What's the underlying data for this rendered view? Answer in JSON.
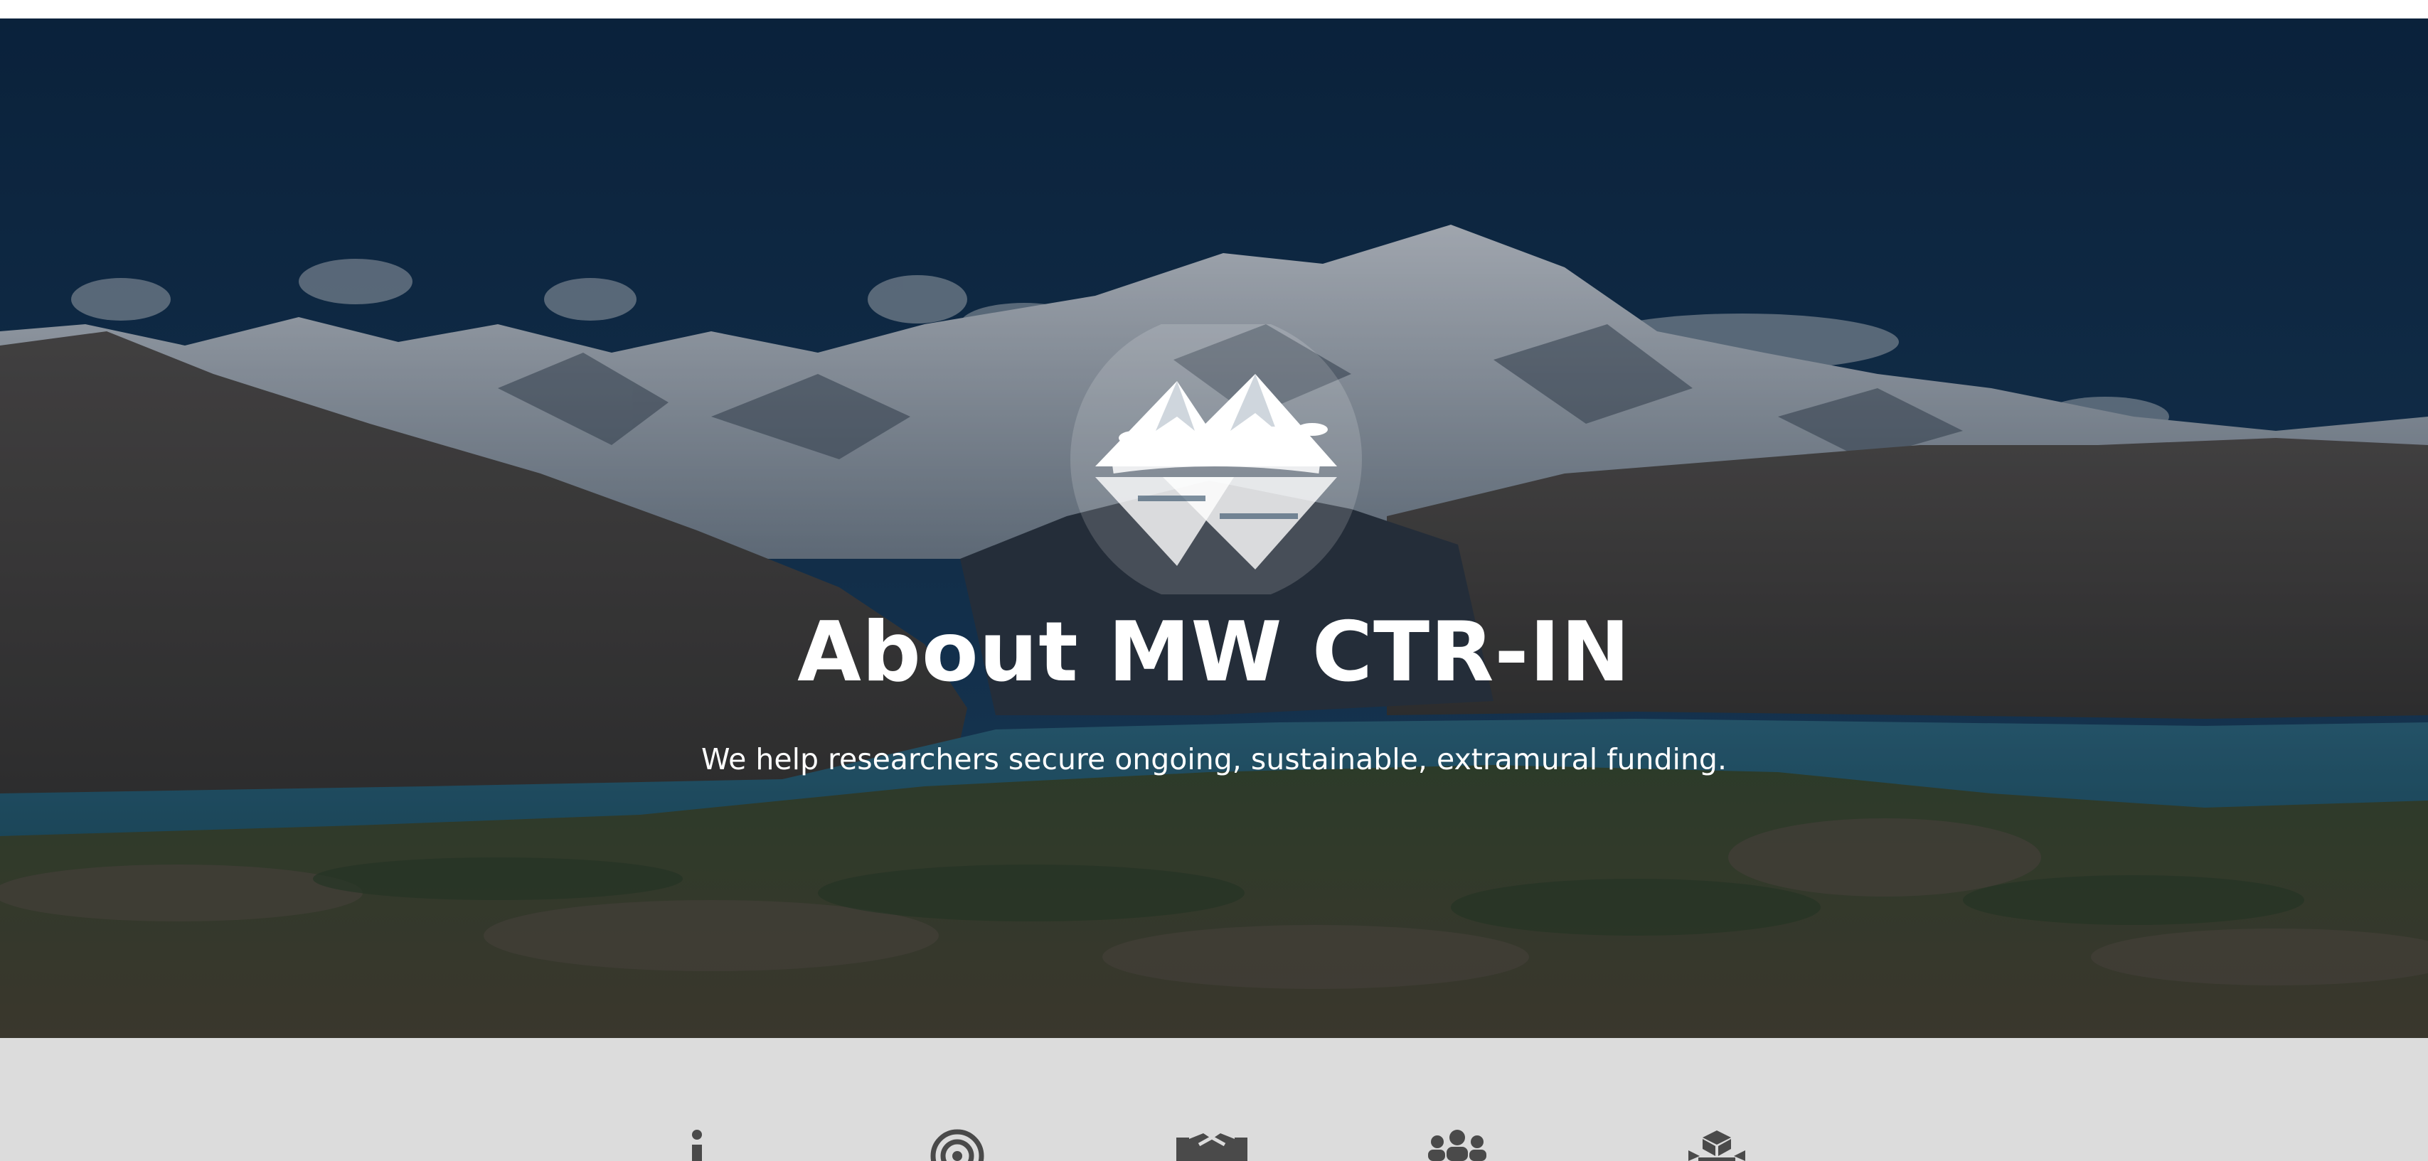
{
  "hero": {
    "title": "About MW CTR-IN",
    "subtitle": "We help researchers secure ongoing, sustainable, extramural funding.",
    "logo_icon": "mountain-reflection-logo"
  },
  "features": {
    "icons": [
      "info-icon",
      "target-icon",
      "handshake-icon",
      "group-icon",
      "stack-icon"
    ]
  },
  "colors": {
    "sky": "#0e2a45",
    "hero_text": "#ffffff",
    "feature_bg": "#dcdcdc",
    "feature_icon": "#4a4a4a"
  }
}
